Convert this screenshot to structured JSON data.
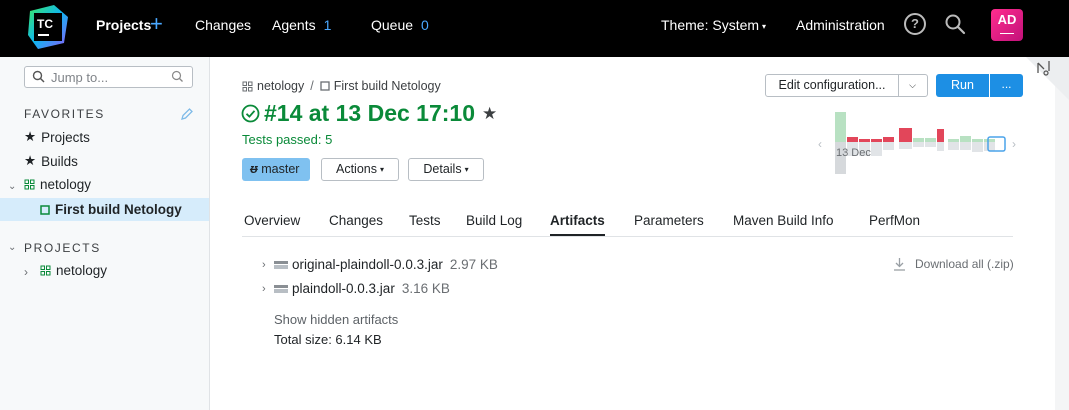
{
  "header": {
    "logo_text": "TC",
    "nav": {
      "projects": "Projects",
      "changes": "Changes",
      "agents": "Agents",
      "agents_count": "1",
      "queue": "Queue",
      "queue_count": "0"
    },
    "theme": "Theme: System",
    "administration": "Administration",
    "avatar_initials": "AD",
    "help_glyph": "?"
  },
  "sidebar": {
    "search_placeholder": "Jump to...",
    "favorites_title": "FAVORITES",
    "favorites": [
      {
        "label": "Projects",
        "icon": "star-icon"
      },
      {
        "label": "Builds",
        "icon": "star-icon"
      },
      {
        "label": "netology",
        "icon": "project-icon"
      },
      {
        "label": "First build Netology",
        "icon": "build-config-icon"
      }
    ],
    "projects_title": "PROJECTS",
    "projects": [
      {
        "label": "netology",
        "icon": "project-icon"
      }
    ]
  },
  "breadcrumb": {
    "project": "netology",
    "separator": "/",
    "build_config": "First build Netology"
  },
  "build": {
    "title": "#14 at 13 Dec 17:10",
    "status_text": "Tests passed: 5",
    "branch": "master",
    "actions_label": "Actions",
    "details_label": "Details"
  },
  "toolbar": {
    "edit_configuration": "Edit configuration...",
    "run": "Run",
    "run_more": "..."
  },
  "timeline": {
    "date_label": "13 Dec"
  },
  "tabs": [
    "Overview",
    "Changes",
    "Tests",
    "Build Log",
    "Artifacts",
    "Parameters",
    "Maven Build Info",
    "PerfMon"
  ],
  "active_tab": "Artifacts",
  "artifacts": {
    "items": [
      {
        "name": "original-plaindoll-0.0.3.jar",
        "size": "2.97 KB"
      },
      {
        "name": "plaindoll-0.0.3.jar",
        "size": "3.16 KB"
      }
    ],
    "download_all": "Download all (.zip)",
    "show_hidden": "Show hidden artifacts",
    "total_size": "Total size: 6.14 KB"
  },
  "colors": {
    "success": "#0a8a39",
    "accent": "#1d8fe4",
    "header_bg": "#000000",
    "fail": "#e2465a"
  }
}
